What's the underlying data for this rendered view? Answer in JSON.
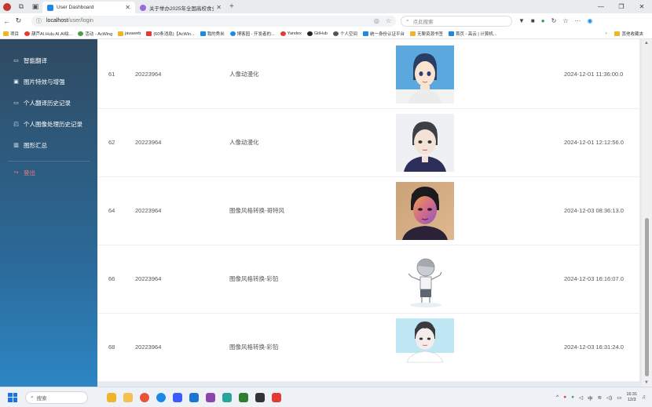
{
  "browser": {
    "tabs": [
      {
        "title": "User Dashboard",
        "active": true
      },
      {
        "title": "关于举办2025年全国高校食业研讨",
        "active": false
      }
    ],
    "url_host": "localhost",
    "url_path": "/user/login",
    "search_placeholder": "点此搜索",
    "bookmarks": [
      "项目",
      "葫芦AI.Hulu AI.AI绘...",
      "活动 - AcWing",
      "javaweb",
      "(60条消息)【AcWin...",
      "我的秀米",
      "博客园 - 开发者的...",
      "Yandex",
      "GitHub",
      "个人空间",
      "统一身份认证平台",
      "无聊资源书签",
      "首页 - 高云 | 计算机..."
    ],
    "bookmarks_other": "其他收藏夹"
  },
  "sidebar": {
    "items": [
      {
        "label": "智能翻译",
        "icon": "translate-icon"
      },
      {
        "label": "图片特效与增强",
        "icon": "image-icon"
      },
      {
        "label": "个人翻译历史记录",
        "icon": "translate-history-icon"
      },
      {
        "label": "个人图像处理历史记录",
        "icon": "image-history-icon"
      },
      {
        "label": "图形汇总",
        "icon": "chart-icon"
      }
    ],
    "logout": "登出"
  },
  "records": [
    {
      "id": "61",
      "user": "20223964",
      "type": "人像动漫化",
      "time": "2024-12-01 11:36:00.0"
    },
    {
      "id": "62",
      "user": "20223964",
      "type": "人像动漫化",
      "time": "2024-12-01 12:12:56.0"
    },
    {
      "id": "64",
      "user": "20223964",
      "type": "图像风格转换-哥特风",
      "time": "2024-12-03 08:36:13.0"
    },
    {
      "id": "66",
      "user": "20223964",
      "type": "图像风格转换-彩铅",
      "time": "2024-12-03 16:16:07.0"
    },
    {
      "id": "68",
      "user": "20223964",
      "type": "图像风格转换-彩铅",
      "time": "2024-12-03 16:31:24.0"
    }
  ],
  "taskbar": {
    "search": "搜索",
    "ime": "中",
    "time": "16:31",
    "date": "12/3"
  }
}
